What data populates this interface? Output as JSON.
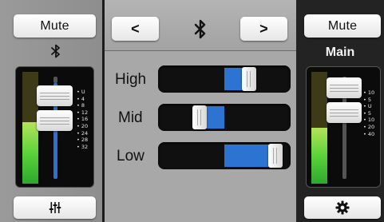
{
  "left_channel": {
    "mute_label": "Mute",
    "source_icon": "bluetooth-icon",
    "scale": [
      "U",
      "4",
      "8",
      "12",
      "16",
      "20",
      "24",
      "28",
      "32"
    ],
    "meter_level": 0.55,
    "eq_button_icon": "eq-sliders-icon"
  },
  "center": {
    "prev_label": "<",
    "next_label": ">",
    "source_icon": "bluetooth-icon",
    "accent": "#2d73d1",
    "eq_bands": [
      {
        "label": "High",
        "level": 0.72
      },
      {
        "label": "Mid",
        "level": 0.28
      },
      {
        "label": "Low",
        "level": 0.96
      }
    ]
  },
  "main_channel": {
    "mute_label": "Mute",
    "name": "Main",
    "scale": [
      "10",
      "5",
      "U",
      "5",
      "10",
      "20",
      "40"
    ],
    "meter_level": 0.5,
    "settings_icon": "gear-icon"
  }
}
